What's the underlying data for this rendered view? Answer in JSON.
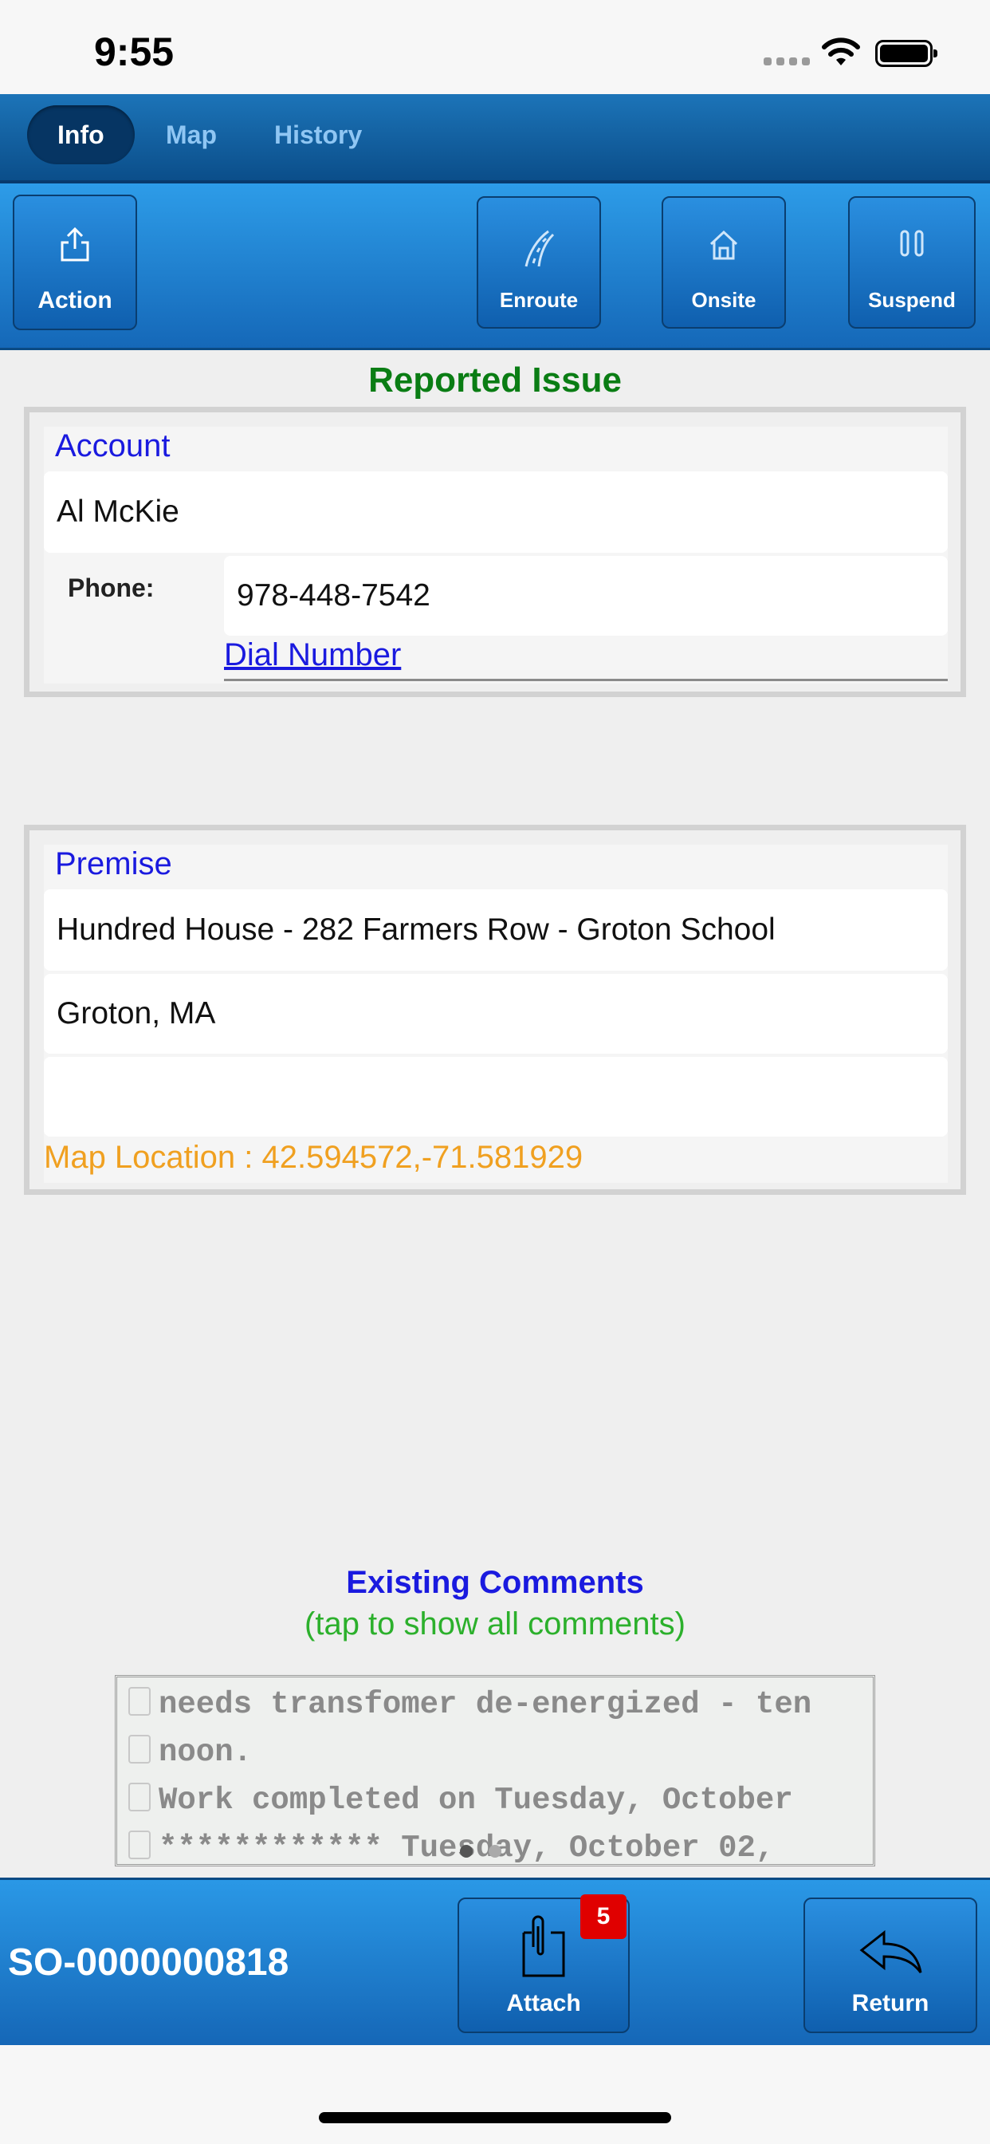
{
  "status_bar": {
    "time": "9:55"
  },
  "tabs": [
    {
      "label": "Info",
      "active": true
    },
    {
      "label": "Map",
      "active": false
    },
    {
      "label": "History",
      "active": false
    }
  ],
  "toolbar": {
    "action_label": "Action",
    "enroute_label": "Enroute",
    "onsite_label": "Onsite",
    "suspend_label": "Suspend"
  },
  "reported_issue": {
    "heading": "Reported Issue"
  },
  "account": {
    "label": "Account",
    "name": "Al McKie",
    "phone_label": "Phone:",
    "phone": "978-448-7542",
    "dial_link": "Dial Number"
  },
  "premise": {
    "label": "Premise",
    "line1": "Hundred House -  282 Farmers Row - Groton School",
    "line2": "Groton, MA",
    "line3": "",
    "map_location": "Map Location : 42.594572,-71.581929"
  },
  "comments": {
    "title": "Existing Comments",
    "subtitle": "(tap to show all comments)",
    "lines": [
      "needs transfomer de-energized - ten",
      "noon.",
      "Work completed on Tuesday, October",
      "************  Tuesday, October 02,"
    ]
  },
  "footer": {
    "order_id": "SO-0000000818",
    "attach_label": "Attach",
    "attach_count": "5",
    "return_label": "Return"
  },
  "colors": {
    "brand_blue": "#1c74b8",
    "heading_green": "#0a7d14",
    "label_blue": "#1a1adf",
    "map_orange": "#f0a020",
    "badge_red": "#e00000"
  }
}
